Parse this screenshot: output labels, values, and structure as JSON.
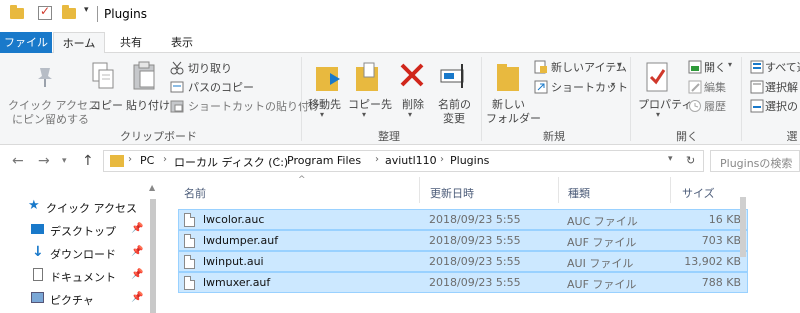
{
  "window": {
    "title": "Plugins"
  },
  "tabs": {
    "file": "ファイル",
    "home": "ホーム",
    "share": "共有",
    "view": "表示"
  },
  "ribbon": {
    "clipboard": {
      "pin_quick": "クイック アクセス",
      "pin_quick2": "にピン留めする",
      "copy": "コピー",
      "paste": "貼り付け",
      "cut": "切り取り",
      "copy_path": "パスのコピー",
      "paste_shortcut": "ショートカットの貼り付け",
      "label": "クリップボード"
    },
    "organize": {
      "move_to": "移動先",
      "copy_to": "コピー先",
      "delete": "削除",
      "rename": "名前の",
      "rename2": "変更",
      "label": "整理"
    },
    "new": {
      "new_folder": "新しい",
      "new_folder2": "フォルダー",
      "new_item": "新しいアイテム",
      "shortcut": "ショートカット",
      "label": "新規"
    },
    "open": {
      "properties": "プロパティ",
      "open": "開く",
      "edit": "編集",
      "history": "履歴",
      "label": "開く"
    },
    "select": {
      "select_all": "すべて選",
      "select_none": "選択解",
      "invert": "選択の",
      "label": "選折"
    }
  },
  "address": {
    "crumbs": [
      "PC",
      "ローカル ディスク (C:)",
      "Program Files",
      "aviutl110",
      "Plugins"
    ],
    "search_placeholder": "Pluginsの検索"
  },
  "nav_pane": {
    "items": [
      {
        "label": "クイック アクセス",
        "icon": "star-icon",
        "pinned": false
      },
      {
        "label": "デスクトップ",
        "icon": "desktop-icon",
        "pinned": true
      },
      {
        "label": "ダウンロード",
        "icon": "download-icon",
        "pinned": true
      },
      {
        "label": "ドキュメント",
        "icon": "document-icon",
        "pinned": true
      },
      {
        "label": "ピクチャ",
        "icon": "picture-icon",
        "pinned": true
      }
    ]
  },
  "file_list": {
    "columns": {
      "name": "名前",
      "date": "更新日時",
      "type": "種類",
      "size": "サイズ"
    },
    "rows": [
      {
        "name": "lwcolor.auc",
        "date": "2018/09/23 5:55",
        "type": "AUC ファイル",
        "size": "16 KB"
      },
      {
        "name": "lwdumper.auf",
        "date": "2018/09/23 5:55",
        "type": "AUF ファイル",
        "size": "703 KB"
      },
      {
        "name": "lwinput.aui",
        "date": "2018/09/23 5:55",
        "type": "AUI ファイル",
        "size": "13,902 KB"
      },
      {
        "name": "lwmuxer.auf",
        "date": "2018/09/23 5:55",
        "type": "AUF ファイル",
        "size": "788 KB"
      }
    ]
  },
  "colors": {
    "accent": "#1979ca",
    "selection": "#cce8ff",
    "selection_border": "#99d1ff",
    "folder": "#e8b93f"
  }
}
